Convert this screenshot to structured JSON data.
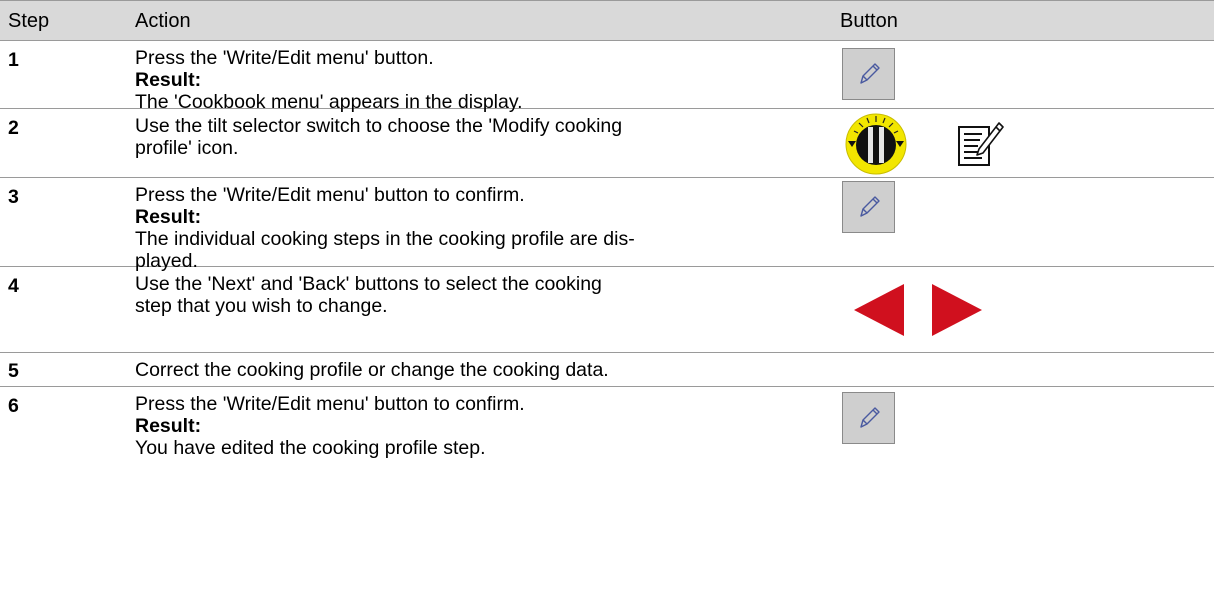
{
  "header": {
    "step": "Step",
    "action": "Action",
    "button": "Button"
  },
  "rows": [
    {
      "step": "1",
      "action": "Press the 'Write/Edit menu' button.",
      "result_label": "Result:",
      "result_text": "The 'Cookbook menu' appears in the display.",
      "icon": "pencil-edit-button-icon"
    },
    {
      "step": "2",
      "action_line1": "Use the tilt selector switch to choose the 'Modify cooking",
      "action_line2": "profile' icon.",
      "icons": [
        "tilt-selector-switch-icon",
        "modify-cooking-profile-icon"
      ]
    },
    {
      "step": "3",
      "action": "Press the 'Write/Edit menu' button to confirm.",
      "result_label": "Result:",
      "result_line1": "The individual cooking steps in the cooking profile are dis-",
      "result_line2": "played.",
      "icon": "pencil-edit-button-icon"
    },
    {
      "step": "4",
      "action_line1": "Use the 'Next' and 'Back' buttons to select the cooking",
      "action_line2": "step that you wish to change.",
      "icons": [
        "back-arrow-icon",
        "next-arrow-icon"
      ]
    },
    {
      "step": "5",
      "action": "Correct the cooking profile or change the cooking data."
    },
    {
      "step": "6",
      "action": "Press the 'Write/Edit menu' button to confirm.",
      "result_label": "Result:",
      "result_text": "You have edited the cooking profile step.",
      "icon": "pencil-edit-button-icon"
    }
  ],
  "colors": {
    "header_bg": "#d9d9d9",
    "arrow_red": "#d0101e",
    "knob_yellow": "#f2e600"
  }
}
